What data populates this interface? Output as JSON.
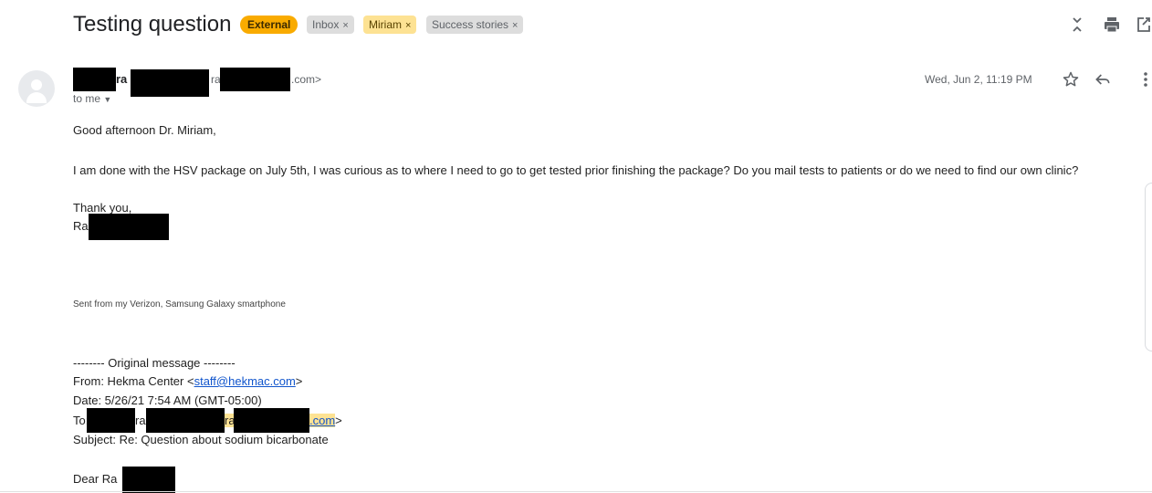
{
  "header": {
    "subject": "Testing question",
    "labels": [
      {
        "text": "External",
        "removable": false
      },
      {
        "text": "Inbox",
        "removable": true
      },
      {
        "text": "Miriam",
        "removable": true
      },
      {
        "text": "Success stories",
        "removable": true
      }
    ],
    "remove_glyph": "×",
    "icons": [
      "expand-collapse-icon",
      "print-icon",
      "open-new-window-icon"
    ]
  },
  "message": {
    "sender_name_visible": "ra",
    "sender_email_fragment_1": "ra",
    "sender_email_suffix": ".com>",
    "recipient_label": "to me",
    "date": "Wed, Jun 2, 11:19 PM",
    "actions": [
      "star-icon",
      "reply-icon",
      "more-options-icon"
    ],
    "body": {
      "greeting": "Good afternoon Dr. Miriam,",
      "paragraph": "I am done with the HSV package on July 5th, I was curious as to where I need to go to get tested prior finishing the package? Do you mail tests to patients or do we need to find our own clinic?",
      "closing": "Thank you,",
      "signature_fragment": "Ra",
      "device_signature": "Sent from my Verizon, Samsung Galaxy smartphone"
    },
    "quoted": {
      "separator": "-------- Original message --------",
      "from_prefix": "From: Hekma Center <",
      "from_email": "staff@hekmac.com",
      "from_suffix": ">",
      "date_line": "Date: 5/26/21 7:54 AM (GMT-05:00)",
      "to_prefix": "To:",
      "to_fragment_1": "ra",
      "to_fragment_2": "ra",
      "to_suffix_link": ".com",
      "to_suffix": ">",
      "subject_line": "Subject: Re: Question about sodium bicarbonate",
      "salutation_fragment": "Dear Ra"
    }
  }
}
